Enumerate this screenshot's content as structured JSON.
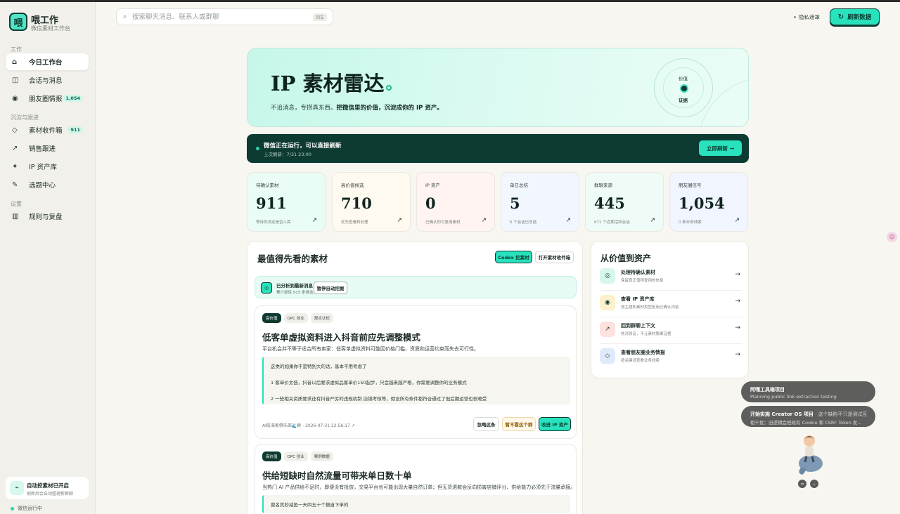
{
  "app": {
    "name": "喂工作",
    "subtitle": "微信素材工作台",
    "logo_char": "喂"
  },
  "sidebar": {
    "sections": [
      "工作",
      "沉淀与跟进",
      "设置"
    ],
    "items": [
      {
        "label": "今日工作台",
        "icon": "⌂"
      },
      {
        "label": "会话与消息",
        "icon": "◫"
      },
      {
        "label": "朋友圈情报",
        "icon": "◉",
        "badge": "1,054"
      },
      {
        "label": "素材收件箱",
        "icon": "◇",
        "badge": "911"
      },
      {
        "label": "销售跟进",
        "icon": "↗"
      },
      {
        "label": "IP 资产库",
        "icon": "✦"
      },
      {
        "label": "选题中心",
        "icon": "✎"
      },
      {
        "label": "规则与复盘",
        "icon": "▥"
      }
    ],
    "auto_title": "自动挖素材已开启",
    "auto_sub": "刷新后会自动整理新群聊",
    "wechat_status": "微信运行中"
  },
  "search": {
    "placeholder": "搜索聊天消息、联系人或群聊",
    "shortcut": "回车"
  },
  "header": {
    "privacy": "隐私遮罩",
    "refresh": "刷新数据"
  },
  "hero": {
    "title": "IP 素材雷达",
    "sub_plain": "不追消息，专捞真东西。",
    "sub_bold": "把微信里的价值，沉淀成你的 IP 资产。",
    "radar_top": "价值",
    "radar_bottom": "证据"
  },
  "status": {
    "title": "微信正在运行，可以直接刷新",
    "sub": "上次刷新：7/31 23:00",
    "button": "立即刷新"
  },
  "stats": [
    {
      "label": "待确认素材",
      "value": "911",
      "hint": "等待你决定是否入库",
      "bg": "#e9fcf6"
    },
    {
      "label": "高价值候选",
      "value": "710",
      "hint": "优先查看和处理",
      "bg": "#fffaf0"
    },
    {
      "label": "IP 资产",
      "value": "0",
      "hint": "已确认的可复用素材",
      "bg": "#fff4f2"
    },
    {
      "label": "单日总结",
      "value": "5",
      "hint": "6 个会话已总结",
      "bg": "#f2f6ff"
    },
    {
      "label": "群聊来源",
      "value": "445",
      "hint": "671 个近期活跃会话",
      "bg": "#eefbf6"
    },
    {
      "label": "朋友圈信号",
      "value": "1,054",
      "hint": "0 条业务线索",
      "bg": "#f1f5ff"
    }
  ],
  "materials": {
    "title": "最值得先看的素材",
    "codex_btn": "Codex 挖素材",
    "open_btn": "打开素材收件箱",
    "analyzed_title": "已分析到最新消息",
    "analyzed_sub": "累计提炼 915 条候选",
    "pause_btn": "暂停自动挖掘",
    "cards": [
      {
        "tags": [
          "高价值",
          "OPC 创业",
          "观点认知"
        ],
        "title": "低客单虚拟资料进入抖音前应先调整模式",
        "desc": "平台机会并不等于适合所有卖家：低客单虚拟资料可能因价格门槛、资质和运营约束而失去可行性。",
        "quotes": [
          "这类的如果你不是特别大的话，基本不用考虑了",
          "1 客单价太低，抖音以后要求虚拟品客单价150起步，只会越来越严格，你需要调整你的业务模式",
          "2 一些相关资质要求还有抖音严厉的违规机制 店铺考核等，假设所有条件都符合通过了但后期运营也很难受"
        ],
        "meta": "AI航海家俱乐部🌊群 · 2026-07-31 22:56:17 ↗",
        "btn_ignore": "忽略这条",
        "btn_skip": "暂不看这个群",
        "btn_collect": "收进 IP 资产"
      },
      {
        "tags": [
          "高价值",
          "OPC 创业",
          "案例数据"
        ],
        "title": "供给短缺时自然流量可带来单日数十单",
        "desc": "当热门 AI 产品供给不足时，即便没有投放，交易平台也可能出现大量自然订单；但无货退款会反向损害店铺评分、供给能力必须先于流量承接。",
        "quotes": [
          "莫名其妙咸鱼一天四五十个擅自下单的"
        ]
      }
    ]
  },
  "value_panel": {
    "title": "从价值到资产",
    "rows": [
      {
        "title": "处理待确认素材",
        "sub": "保留真正值得复用的信息",
        "icon": "◎",
        "bg": "#d6f7ec"
      },
      {
        "title": "查看 IP 资产库",
        "sub": "按主题和素材类型复用已确认内容",
        "icon": "◉",
        "bg": "#fdf1cc"
      },
      {
        "title": "回到群聊上下文",
        "sub": "核对原话，不让素材脱离证据",
        "icon": "↗",
        "bg": "#fde2dd"
      },
      {
        "title": "查看朋友圈业务情报",
        "sub": "按关键词查看业务线索",
        "icon": "◇",
        "bg": "#e0e9fb"
      }
    ]
  },
  "toasts": [
    {
      "title": "阿嘿工具箱项目",
      "sub": "Planning public link extraction testing"
    },
    {
      "title": "开始实施 Creator OS 项目",
      "title_extra": " · 这个缺陷不只是测试互",
      "sub": "相干扰：旧逻辑会把现有 Cookie 和 CSRF Token 发..."
    }
  ],
  "colors": {
    "accent": "#27e2bc",
    "dark": "#0d3a31",
    "background": "#f7f6f1"
  }
}
